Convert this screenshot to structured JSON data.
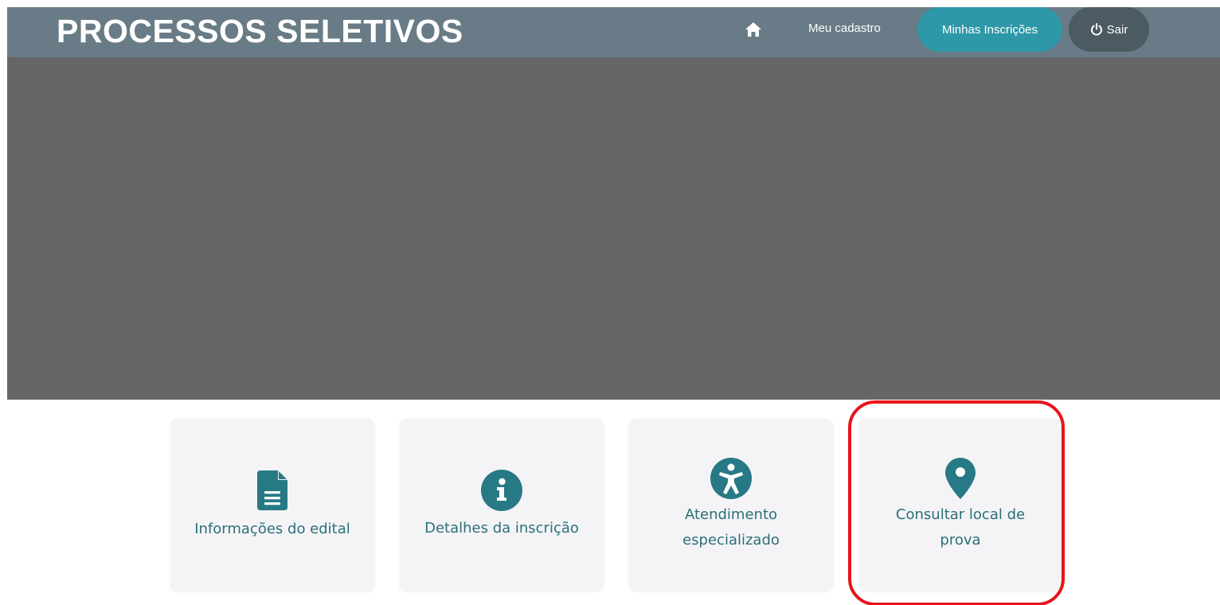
{
  "header": {
    "brand": "PROCESSOS SELETIVOS",
    "home_icon": "home-icon",
    "nav_cadastro": "Meu cadastro",
    "nav_inscricoes": "Minhas Inscrições",
    "nav_sair": "Sair",
    "sair_icon": "power-icon"
  },
  "cards": [
    {
      "icon": "document-icon",
      "label": "Informações do edital"
    },
    {
      "icon": "info-icon",
      "label": "Detalhes da inscrição"
    },
    {
      "icon": "accessibility-icon",
      "label": "Atendimento\nespecializado"
    },
    {
      "icon": "map-pin-icon",
      "label": "Consultar local de\nprova"
    }
  ],
  "colors": {
    "header_bg": "#687b86",
    "accent_pill": "#2e98a8",
    "sair_pill": "#4c5a62",
    "hero_bg": "#666666",
    "card_bg": "#f4f4f6",
    "icon_teal": "#277985",
    "highlight": "#e8141b"
  }
}
